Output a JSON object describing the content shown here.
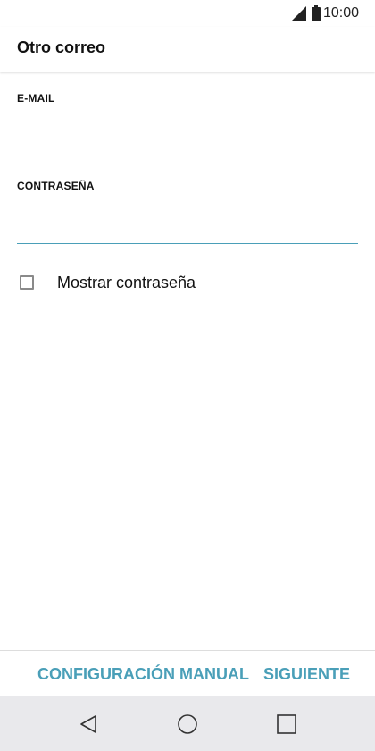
{
  "status_bar": {
    "time": "10:00",
    "icons": [
      "signal-icon",
      "battery-icon"
    ]
  },
  "header": {
    "title": "Otro correo"
  },
  "form": {
    "email": {
      "label": "E-MAIL",
      "value": "",
      "placeholder": ""
    },
    "password": {
      "label": "CONTRASEÑA",
      "value": "",
      "placeholder": ""
    },
    "show_password": {
      "label": "Mostrar contraseña",
      "checked": false
    }
  },
  "actions": {
    "manual_label": "CONFIGURACIÓN MANUAL",
    "next_label": "SIGUIENTE"
  },
  "nav_bar": {
    "icons": [
      "back-icon",
      "home-icon",
      "recents-icon"
    ]
  },
  "colors": {
    "accent": "#4a9fb8",
    "nav_bar_bg": "#e9e9ec"
  }
}
